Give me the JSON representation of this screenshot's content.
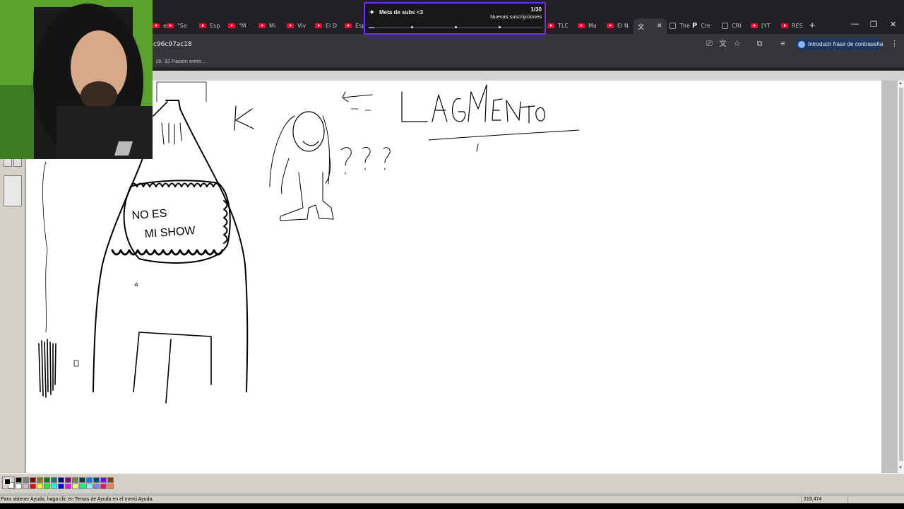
{
  "browser": {
    "tabs": [
      {
        "label": "e",
        "favicon": "youtube-icon"
      },
      {
        "label": "\"Se",
        "favicon": "youtube-icon"
      },
      {
        "label": "Esp",
        "favicon": "youtube-icon"
      },
      {
        "label": "\"M",
        "favicon": "youtube-icon"
      },
      {
        "label": "Mi",
        "favicon": "youtube-icon"
      },
      {
        "label": "Viv",
        "favicon": "youtube-icon"
      },
      {
        "label": "El D",
        "favicon": "youtube-icon"
      },
      {
        "label": "Esp",
        "favicon": "youtube-icon"
      },
      {
        "label": "TLC",
        "favicon": "youtube-icon"
      },
      {
        "label": "Ma",
        "favicon": "youtube-icon"
      },
      {
        "label": "El N",
        "favicon": "youtube-icon"
      },
      {
        "label": "",
        "favicon": "translate-icon"
      },
      {
        "label": "The",
        "favicon": "generic-icon"
      },
      {
        "label": "Cre",
        "favicon": "patreon-icon"
      },
      {
        "label": "CRI",
        "favicon": "generic-icon"
      },
      {
        "label": "[YT",
        "favicon": "youtube-icon"
      },
      {
        "label": "RES",
        "favicon": "youtube-icon"
      }
    ],
    "url": "c96c97ac18",
    "password_chip": "Introducir frase de contraseña",
    "bookmark": "16: 33 Pasión entre..."
  },
  "subgoal": {
    "title": "Meta de subs <3",
    "count": "1/30",
    "label": "Nuevas suscripciones",
    "progress": 0.033
  },
  "drawing": {
    "sign_line1": "NO ES",
    "sign_line2": "MI SHOW",
    "scribble_title": "LAGMENTO",
    "question": "¿??"
  },
  "paint": {
    "palette": [
      "#000000",
      "#808080",
      "#800000",
      "#808000",
      "#008000",
      "#008080",
      "#000080",
      "#800080",
      "#808040",
      "#004040",
      "#0080ff",
      "#004080",
      "#8000ff",
      "#804000",
      "#ffffff",
      "#c0c0c0",
      "#ff0000",
      "#ffff00",
      "#00ff00",
      "#00ffff",
      "#0000ff",
      "#ff00ff",
      "#ffff80",
      "#00ff80",
      "#80ffff",
      "#8080ff",
      "#ff0080",
      "#ff8040"
    ],
    "status_help": "Para obtener Ayuda, haga clic en Temas de Ayuda en el menú Ayuda.",
    "coords": "219,474"
  }
}
